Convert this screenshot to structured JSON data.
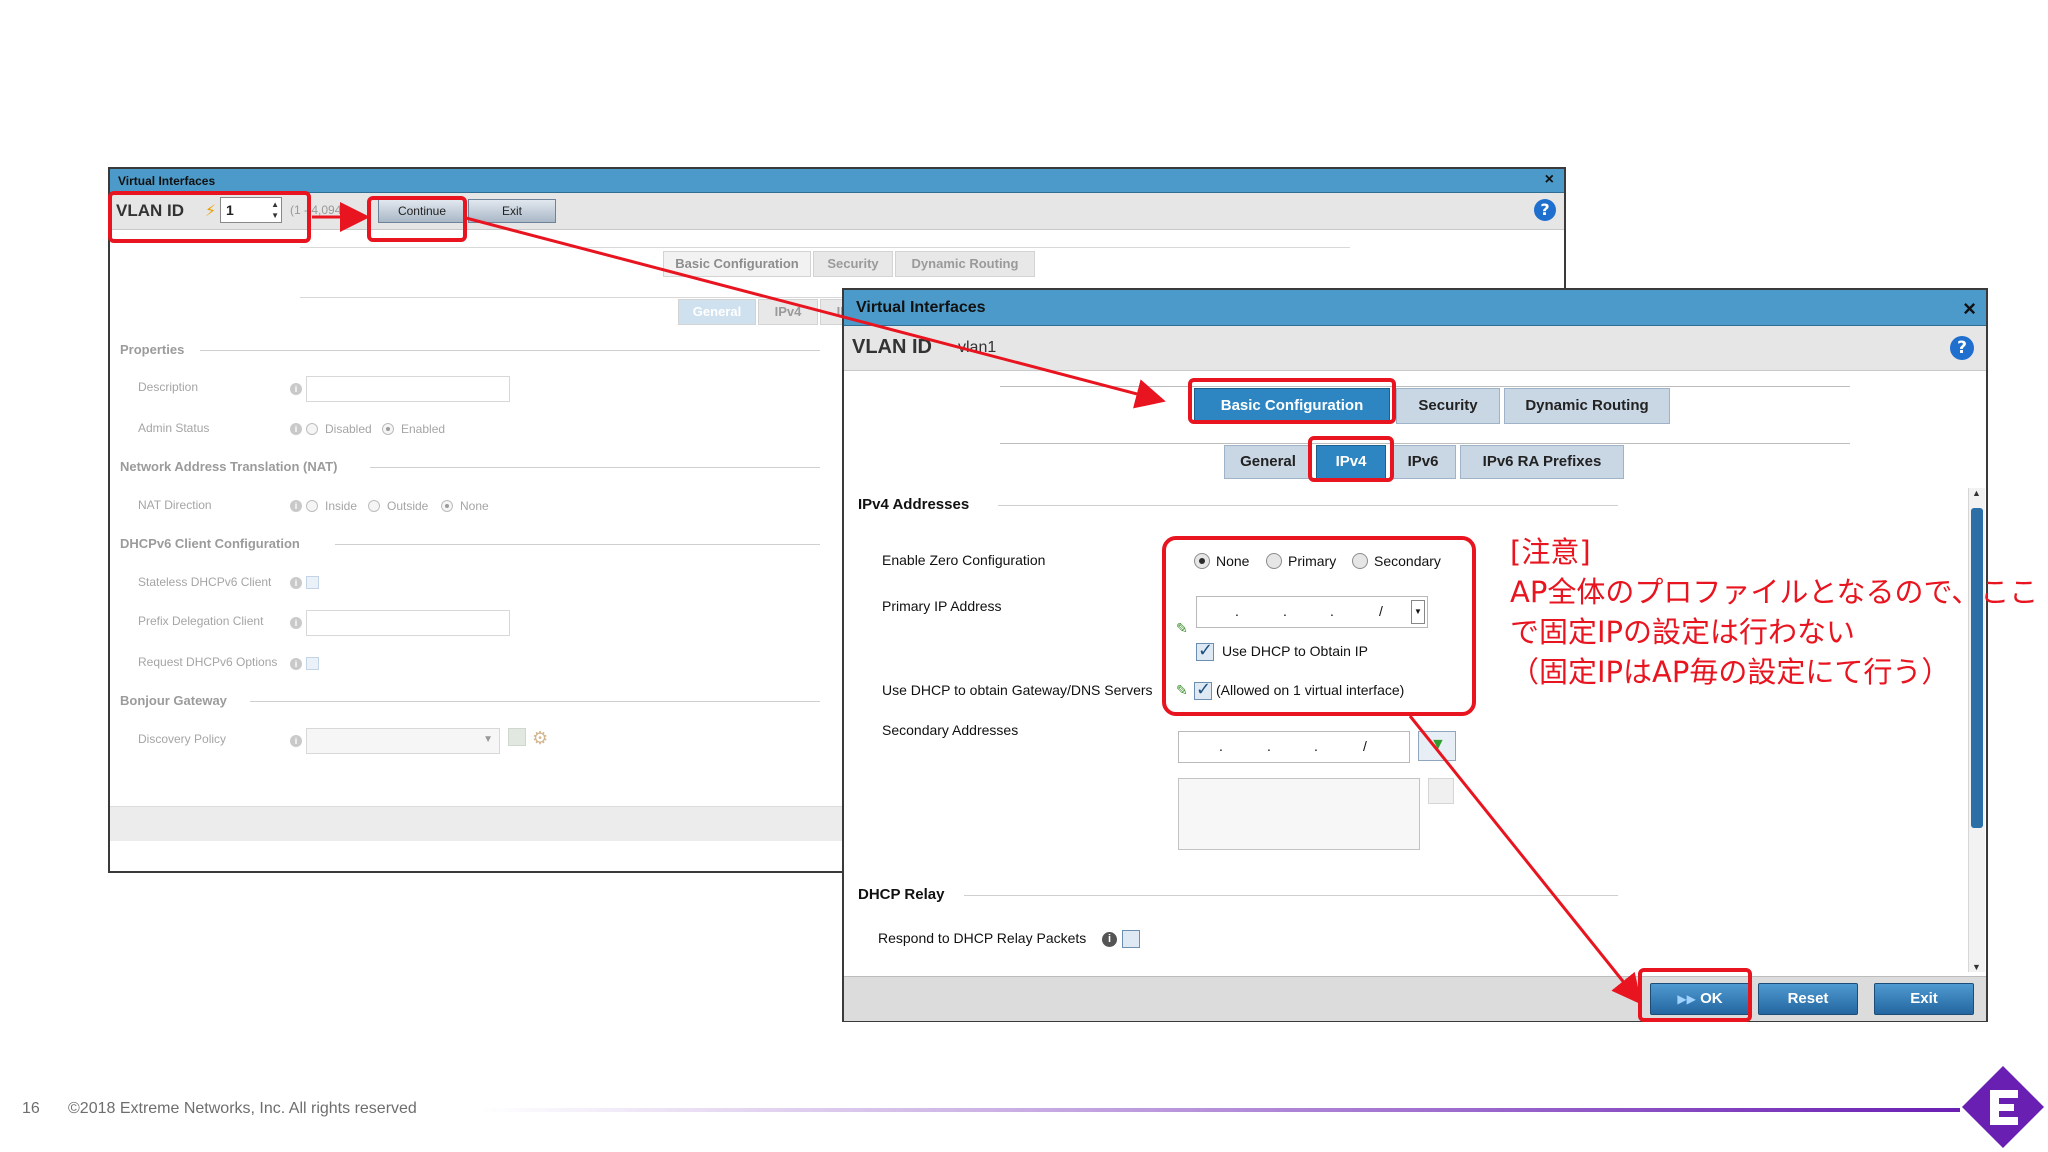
{
  "bg_window": {
    "title": "Virtual Interfaces",
    "close": "×",
    "vlan_label": "VLAN ID",
    "vlan_value": "1",
    "range_hint": "(1 - 4,094)",
    "continue_label": "Continue",
    "exit_label": "Exit",
    "help": "?",
    "tabs": [
      "Basic Configuration",
      "Security",
      "Dynamic Routing"
    ],
    "subtabs": [
      "General",
      "IPv4",
      "IPv6"
    ],
    "sections": {
      "properties": "Properties",
      "nat": "Network Address Translation (NAT)",
      "dhcpv6": "DHCPv6 Client Configuration",
      "bonjour": "Bonjour Gateway"
    },
    "fields": {
      "description": "Description",
      "admin_status": "Admin Status",
      "admin_disabled": "Disabled",
      "admin_enabled": "Enabled",
      "nat_direction": "NAT Direction",
      "nat_inside": "Inside",
      "nat_outside": "Outside",
      "nat_none": "None",
      "stateless": "Stateless DHCPv6 Client",
      "prefix": "Prefix Delegation Client",
      "request": "Request DHCPv6 Options",
      "discovery": "Discovery Policy"
    }
  },
  "fg_window": {
    "title": "Virtual Interfaces",
    "close": "×",
    "vlan_label": "VLAN ID",
    "vlan_value": "vlan1",
    "help": "?",
    "tabs": [
      "Basic Configuration",
      "Security",
      "Dynamic Routing"
    ],
    "subtabs": [
      "General",
      "IPv4",
      "IPv6",
      "IPv6 RA Prefixes"
    ],
    "ipv4_section": "IPv4 Addresses",
    "enable_zero": "Enable Zero Configuration",
    "zero_none": "None",
    "zero_primary": "Primary",
    "zero_secondary": "Secondary",
    "primary_ip": "Primary IP Address",
    "ip_dots": ".",
    "ip_slash": "/",
    "use_dhcp": "Use DHCP to Obtain IP",
    "use_dhcp_gw": "Use DHCP to obtain Gateway/DNS Servers",
    "allowed_on": "(Allowed on 1 virtual interface)",
    "secondary": "Secondary Addresses",
    "dhcp_relay_section": "DHCP Relay",
    "respond_relay": "Respond to DHCP Relay Packets",
    "ok_label": "OK",
    "reset_label": "Reset",
    "exit_label": "Exit"
  },
  "annotation": {
    "line1": "[注意]",
    "line2": "AP全体のプロファイルとなるので、ここ",
    "line3": "で固定IPの設定は行わない",
    "line4": "（固定IPはAP毎の設定にて行う）"
  },
  "footer": {
    "page_number": "16",
    "copyright": "©2018 Extreme Networks, Inc.  All rights reserved"
  },
  "colors": {
    "title_bar": "#4b9ac9",
    "accent_red": "#e8141f",
    "selected_tab": "#2d86c2",
    "brand_purple": "#6a1fb3"
  }
}
